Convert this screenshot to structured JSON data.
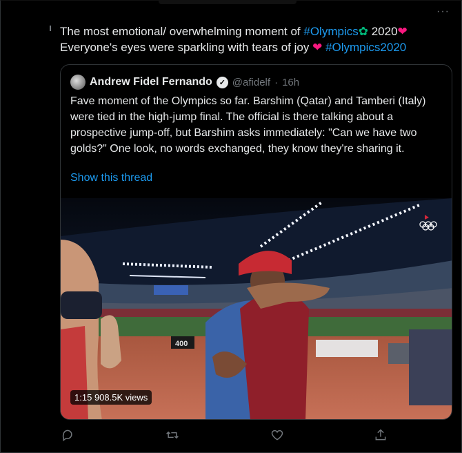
{
  "tweet": {
    "line1_prefix": "The most emotional/ overwhelming moment of ",
    "line1_tag": "#Olympics",
    "line1_year": " 2020",
    "line2_prefix": "Everyone's eyes were sparkling with tears of joy ",
    "line2_tag": "#Olympics2020",
    "more_label": "···"
  },
  "quoted": {
    "author_name": "Andrew Fidel Fernando",
    "author_handle": "@afidelf",
    "separator": "·",
    "time": "16h",
    "text": "Fave moment of the Olympics so far. Barshim (Qatar) and Tamberi (Italy) were tied in the high-jump final. The official is there talking about a prospective jump-off, but Barshim asks immediately: \"Can we have two golds?\" One look, no words exchanged, they know they're sharing it.",
    "thread_link": "Show this thread",
    "video": {
      "duration": "1:15",
      "views": "908.5K views",
      "scoreboard": "400"
    }
  },
  "icons": {
    "reply": "reply-icon",
    "retweet": "retweet-icon",
    "like": "heart-icon",
    "share": "share-icon",
    "verified": "verified-badge-icon",
    "olympic_rings": "olympic-rings-icon"
  },
  "colors": {
    "background": "#000000",
    "text": "#e7e9ea",
    "link": "#1d9bf0",
    "muted": "#71767b",
    "heart": "#f91880"
  }
}
